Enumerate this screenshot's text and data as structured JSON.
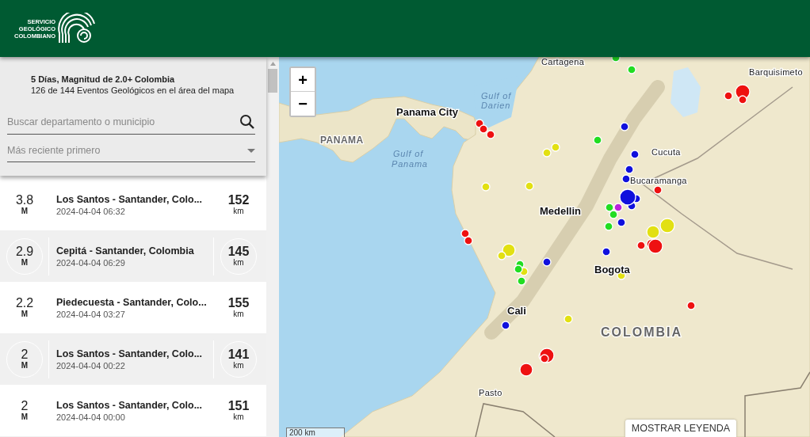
{
  "header": {
    "logo_lines": [
      "SERVICIO",
      "GEOLÓGICO",
      "COLOMBIANO"
    ]
  },
  "sidebar": {
    "title": "5 Días, Magnitud de 2.0+ Colombia",
    "subtitle": "126 de 144 Eventos Geológicos en el área del mapa",
    "search": {
      "placeholder": "Buscar departamento o municipio"
    },
    "sort": {
      "value": "Más reciente primero"
    },
    "events": [
      {
        "magnitude": "3.8",
        "magnitude_unit": "M",
        "place": "Los Santos - Santander, Colo...",
        "time": "2024-04-04 06:32",
        "depth": "152",
        "depth_unit": "km"
      },
      {
        "magnitude": "2.9",
        "magnitude_unit": "M",
        "place": "Cepitá - Santander, Colombia",
        "time": "2024-04-04 06:29",
        "depth": "145",
        "depth_unit": "km"
      },
      {
        "magnitude": "2.2",
        "magnitude_unit": "M",
        "place": "Piedecuesta - Santander, Colo...",
        "time": "2024-04-04 03:27",
        "depth": "155",
        "depth_unit": "km"
      },
      {
        "magnitude": "2",
        "magnitude_unit": "M",
        "place": "Los Santos - Santander, Colo...",
        "time": "2024-04-04 00:22",
        "depth": "141",
        "depth_unit": "km"
      },
      {
        "magnitude": "2",
        "magnitude_unit": "M",
        "place": "Los Santos - Santander, Colo...",
        "time": "2024-04-04 00:00",
        "depth": "151",
        "depth_unit": "km"
      }
    ]
  },
  "map": {
    "zoom_in": "+",
    "zoom_out": "−",
    "labels": [
      {
        "text": "Cartagena",
        "kind": "city"
      },
      {
        "text": "Barquisimeto",
        "kind": "city"
      },
      {
        "text": "Gulf of",
        "kind": "water"
      },
      {
        "text": "Darien",
        "kind": "water"
      },
      {
        "text": "Panama City",
        "kind": "capital"
      },
      {
        "text": "PANAMA",
        "kind": "country"
      },
      {
        "text": "Cucuta",
        "kind": "city"
      },
      {
        "text": "Gulf of",
        "kind": "water"
      },
      {
        "text": "Panama",
        "kind": "water"
      },
      {
        "text": "Bucaramanga",
        "kind": "city"
      },
      {
        "text": "Medellin",
        "kind": "capital"
      },
      {
        "text": "Bogota",
        "kind": "capital"
      },
      {
        "text": "Cali",
        "kind": "capital"
      },
      {
        "text": "COLOMBIA",
        "kind": "country"
      },
      {
        "text": "Pasto",
        "kind": "city"
      }
    ],
    "scale": "200 km",
    "legend_button": "MOSTRAR LEYENDA"
  }
}
